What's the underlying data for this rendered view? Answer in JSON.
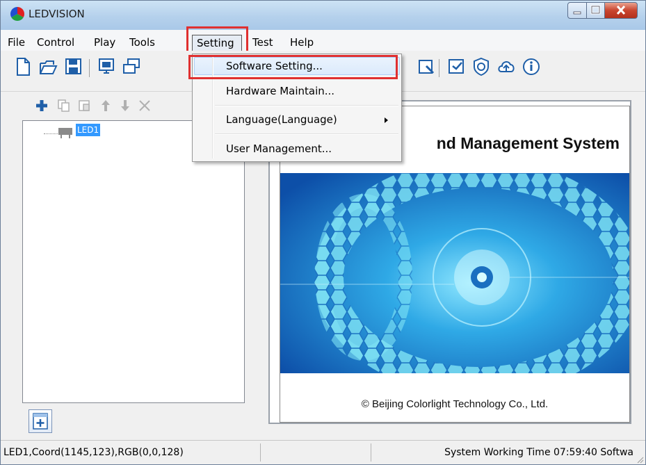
{
  "window": {
    "title": "LEDVISION"
  },
  "menubar": {
    "items": [
      "File",
      "Control",
      "Play",
      "Tools",
      "Setting",
      "Test",
      "Help"
    ],
    "active": "Setting"
  },
  "toolbar": {
    "icons": [
      "new-file-icon",
      "open-folder-icon",
      "save-icon",
      "monitor-icon",
      "window-icon",
      "screen-config-icon",
      "display-settings-icon",
      "shield-icon",
      "cloud-upload-icon",
      "info-icon"
    ]
  },
  "setting_menu": {
    "items": [
      {
        "label": "Software Setting...",
        "highlighted": true
      },
      {
        "label": "Hardware Maintain..."
      },
      {
        "label": "Language(Language)",
        "submenu": true
      },
      {
        "label": "User Management..."
      }
    ]
  },
  "left_panel": {
    "tool_icons": [
      "add-icon",
      "copy-icon",
      "paste-icon",
      "move-up-icon",
      "move-down-icon",
      "delete-icon"
    ],
    "tree": [
      {
        "label": "LED1",
        "selected": true
      }
    ]
  },
  "splash": {
    "title_visible": "nd Management System",
    "footer": "© Beijing Colorlight Technology Co., Ltd."
  },
  "statusbar": {
    "left": "LED1,Coord(1145,123),RGB(0,0,128)",
    "right": "System Working Time 07:59:40 Softwa"
  },
  "colors": {
    "annotation_red": "#e03030",
    "selection_blue": "#3399ff",
    "splash_blue": "#1a6fc0"
  }
}
